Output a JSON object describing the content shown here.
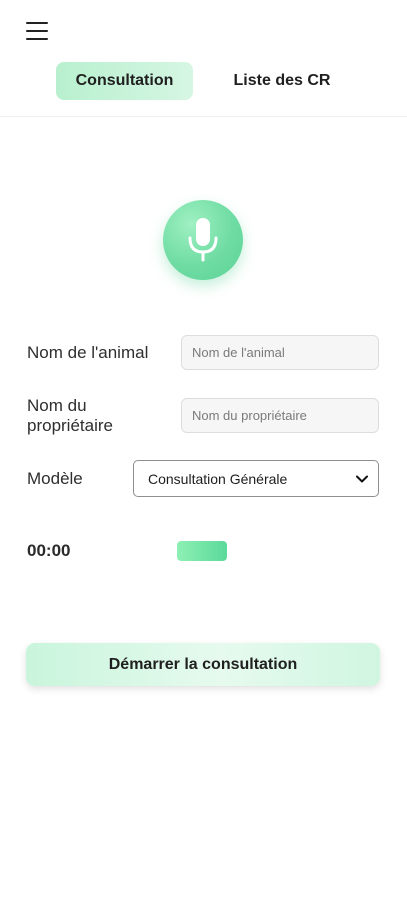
{
  "header": {
    "menu_icon": "hamburger-menu-icon",
    "tabs": [
      {
        "label": "Consultation",
        "active": true
      },
      {
        "label": "Liste des CR",
        "active": false
      }
    ]
  },
  "recorder": {
    "mic_icon": "microphone-icon",
    "accent_color": "#6fdca3"
  },
  "form": {
    "animal_name": {
      "label": "Nom de l'animal",
      "placeholder": "Nom de l'animal",
      "value": ""
    },
    "owner_name": {
      "label_line1": "Nom du",
      "label_line2": "propriétaire",
      "placeholder": "Nom du propriétaire",
      "value": ""
    },
    "model": {
      "label": "Modèle",
      "selected": "Consultation Générale"
    }
  },
  "status": {
    "timer": "00:00",
    "level": 1.0
  },
  "actions": {
    "start_label": "Démarrer la consultation"
  }
}
